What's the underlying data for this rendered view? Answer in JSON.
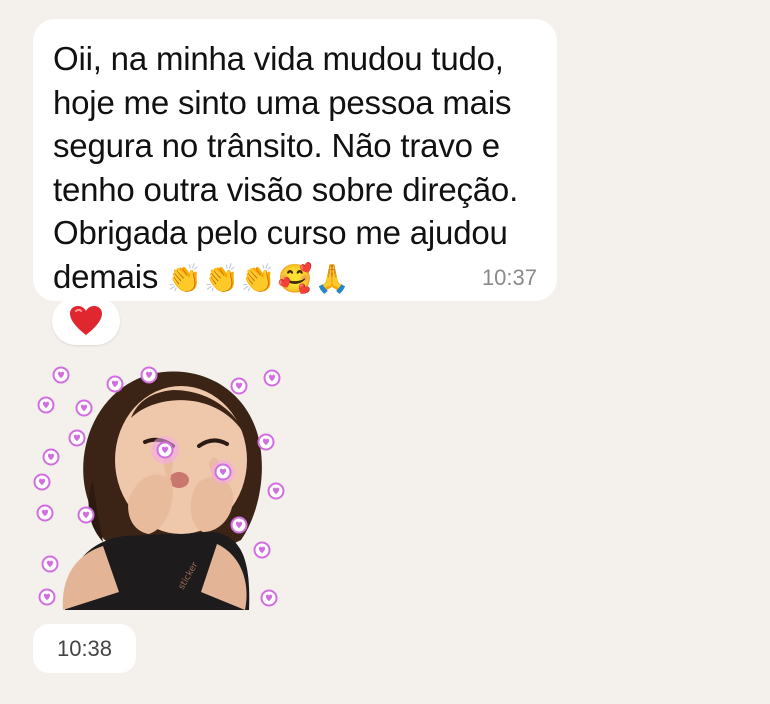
{
  "message": {
    "lines": [
      "Oii, na minha vida mudou tudo,",
      "hoje me sinto uma pessoa mais",
      "segura no trânsito. Não travo e",
      "tenho outra visão sobre direção.",
      "Obrigada pelo curso me ajudou",
      "demais"
    ],
    "emojis": [
      "clapping-hands-emoji",
      "clapping-hands-emoji",
      "clapping-hands-emoji",
      "smiling-face-with-hearts-emoji",
      "folded-hands-emoji"
    ],
    "time": "10:37"
  },
  "reaction": {
    "icon": "red-heart-icon",
    "color": "#e0262e"
  },
  "sticker": {
    "icon": "girl-blowing-kiss-sticker",
    "heart_color": "#d16ee0"
  },
  "sticker_time": "10:38"
}
